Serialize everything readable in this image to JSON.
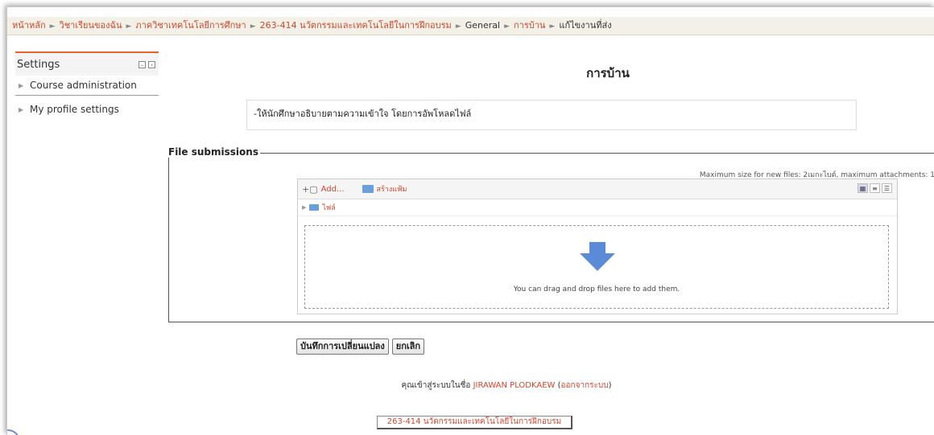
{
  "breadcrumb": {
    "items": [
      "หน้าหลัก",
      "วิชาเรียนของฉัน",
      "ภาควิชาเทคโนโลยีการศึกษา",
      "263-414 นวัตกรรมและเทคโนโลยีในการฝึกอบรม"
    ],
    "general": "General",
    "homework": "การบ้าน",
    "current": "แก้ไขงานที่ส่ง",
    "separator": "►"
  },
  "settings_block": {
    "title": "Settings",
    "items": [
      "Course administration",
      "My profile settings"
    ]
  },
  "page": {
    "title": "การบ้าน",
    "intro": "-ให้นักศึกษาอธิบายตามความเข้าใจ โดยการอัพโหลดไฟล์"
  },
  "file_submissions": {
    "legend": "File submissions",
    "max_size": "Maximum size for new files: 2เมกะไบต์, maximum attachments: 1",
    "add_label": "Add...",
    "create_folder_label": "สร้างแฟ้ม",
    "path_label": "ไฟล์",
    "drop_text": "You can drag and drop files here to add them."
  },
  "buttons": {
    "save": "บันทึกการเปลี่ยนแปลง",
    "cancel": "ยกเลิก"
  },
  "login_info": {
    "prefix": "คุณเข้าสู่ระบบในชื่อ",
    "user": "JIRAWAN PLODKAEW",
    "logout": "ออกจากระบบ"
  },
  "course_link": "263-414 นวัตกรรมและเทคโนโลยีในการฝึกอบรม",
  "colors": {
    "link": "#d1462f",
    "accent": "#e8632b",
    "folder": "#6a9fd8",
    "arrow": "#5b8ad6"
  }
}
